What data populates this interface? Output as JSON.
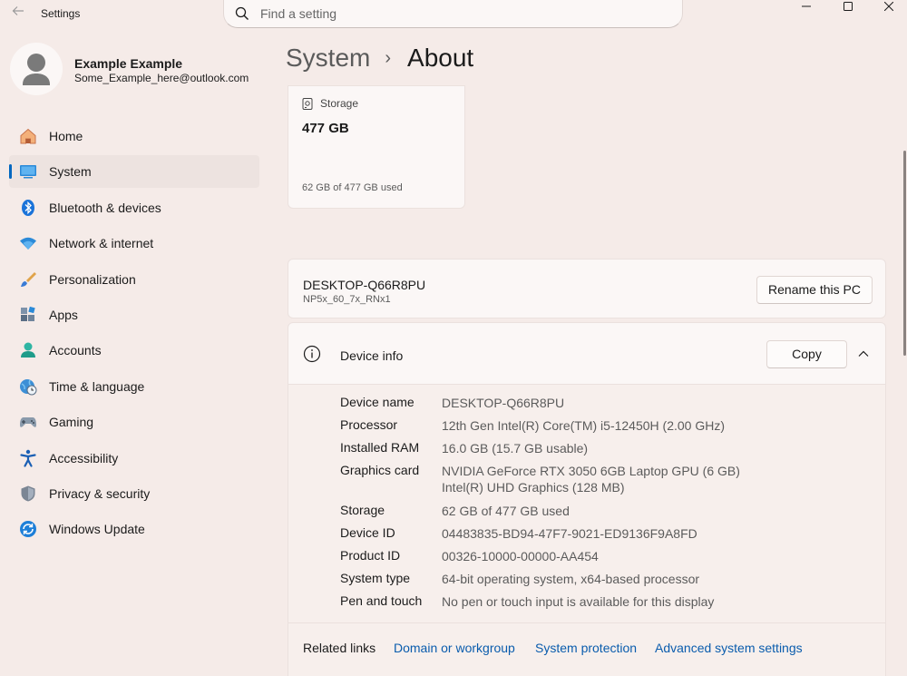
{
  "titlebar": {
    "app_title": "Settings",
    "search_placeholder": "Find a setting"
  },
  "profile": {
    "name": "Example Example",
    "email": "Some_Example_here@outlook.com"
  },
  "sidebar": {
    "items": [
      {
        "label": "Home",
        "icon": "home-icon",
        "active": false
      },
      {
        "label": "System",
        "icon": "system-icon",
        "active": true
      },
      {
        "label": "Bluetooth & devices",
        "icon": "bluetooth-icon",
        "active": false
      },
      {
        "label": "Network & internet",
        "icon": "wifi-icon",
        "active": false
      },
      {
        "label": "Personalization",
        "icon": "brush-icon",
        "active": false
      },
      {
        "label": "Apps",
        "icon": "apps-icon",
        "active": false
      },
      {
        "label": "Accounts",
        "icon": "accounts-icon",
        "active": false
      },
      {
        "label": "Time & language",
        "icon": "globe-clock-icon",
        "active": false
      },
      {
        "label": "Gaming",
        "icon": "gamepad-icon",
        "active": false
      },
      {
        "label": "Accessibility",
        "icon": "accessibility-icon",
        "active": false
      },
      {
        "label": "Privacy & security",
        "icon": "shield-icon",
        "active": false
      },
      {
        "label": "Windows Update",
        "icon": "update-icon",
        "active": false
      }
    ]
  },
  "breadcrumb": {
    "parent": "System",
    "separator": "›",
    "current": "About"
  },
  "storage_card": {
    "label": "Storage",
    "total": "477 GB",
    "used": "62 GB of 477 GB used"
  },
  "pc_card": {
    "name": "DESKTOP-Q66R8PU",
    "model": "NP5x_60_7x_RNx1",
    "rename_label": "Rename this PC"
  },
  "device_info": {
    "title": "Device info",
    "copy_label": "Copy",
    "rows": [
      {
        "key": "Device name",
        "value": "DESKTOP-Q66R8PU"
      },
      {
        "key": "Processor",
        "value": "12th Gen Intel(R) Core(TM) i5-12450H (2.00 GHz)"
      },
      {
        "key": "Installed RAM",
        "value": "16.0 GB (15.7 GB usable)"
      },
      {
        "key": "Graphics card",
        "value": "NVIDIA GeForce RTX 3050 6GB Laptop GPU (6 GB)",
        "value2": "Intel(R) UHD Graphics (128 MB)"
      },
      {
        "key": "Storage",
        "value": "62 GB of 477 GB used"
      },
      {
        "key": "Device ID",
        "value": "04483835-BD94-47F7-9021-ED9136F9A8FD"
      },
      {
        "key": "Product ID",
        "value": "00326-10000-00000-AA454"
      },
      {
        "key": "System type",
        "value": "64-bit operating system, x64-based processor"
      },
      {
        "key": "Pen and touch",
        "value": "No pen or touch input is available for this display"
      }
    ]
  },
  "related_links": {
    "label": "Related links",
    "links": [
      "Domain or workgroup",
      "System protection",
      "Advanced system settings"
    ]
  },
  "colors": {
    "accent": "#0067c0",
    "link": "#0a5cad",
    "background": "#f5ebe8"
  }
}
